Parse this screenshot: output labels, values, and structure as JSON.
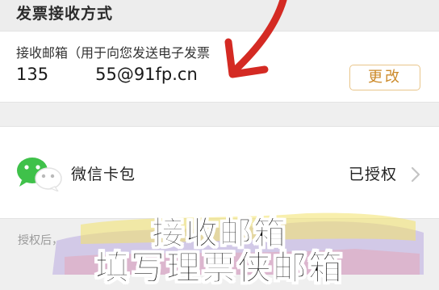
{
  "invoice_section": {
    "title": "发票接收方式"
  },
  "email": {
    "label": "接收邮箱（用于向您发送电子发票",
    "value_prefix": "135",
    "value_suffix": "55@91fp.cn",
    "change_label": "更改"
  },
  "wechat": {
    "label": "微信卡包",
    "status": "已授权",
    "icon": "wechat-icon"
  },
  "footnote": {
    "text": "授权后，"
  },
  "overlay": {
    "caption_line1": "接收邮箱",
    "caption_line2": "填写理票侠邮箱",
    "arrow_color": "#d42a23",
    "accent_color": "#cc8a2a"
  }
}
